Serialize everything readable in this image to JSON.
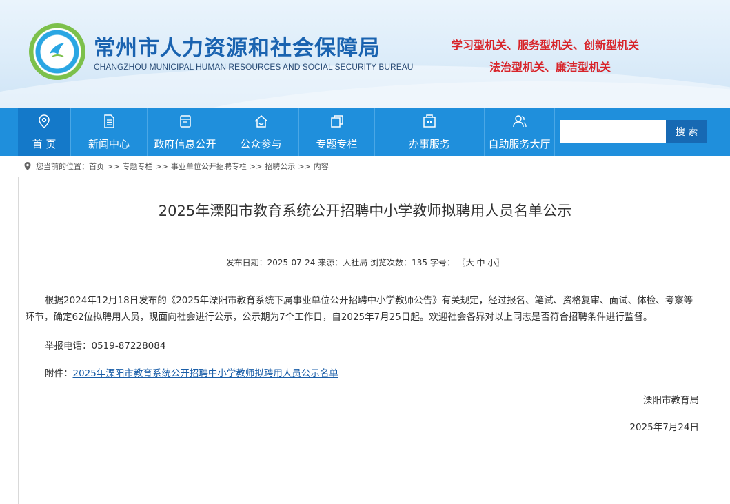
{
  "header": {
    "title": "常州市人力资源和社会保障局",
    "subtitle": "CHANGZHOU MUNICIPAL HUMAN RESOURCES AND SOCIAL SECURITY BUREAU",
    "slogan_line1": "学习型机关、服务型机关、创新型机关",
    "slogan_line2": "法治型机关、廉洁型机关",
    "colors": {
      "title": "#1a63b0",
      "slogan": "#d8242a",
      "nav": "#1f8fdc"
    }
  },
  "nav": {
    "items": [
      {
        "label": "首 页",
        "icon": "location-pin-icon",
        "active": true
      },
      {
        "label": "新闻中心",
        "icon": "document-icon"
      },
      {
        "label": "政府信息公开",
        "icon": "inbox-icon"
      },
      {
        "label": "公众参与",
        "icon": "house-icon"
      },
      {
        "label": "专题专栏",
        "icon": "copy-icon"
      },
      {
        "label": "办事服务",
        "icon": "building-icon"
      },
      {
        "label": "自助服务大厅",
        "icon": "users-icon"
      }
    ],
    "search_button": "搜 索",
    "search_value": ""
  },
  "breadcrumb": {
    "prefix": "您当前的位置：",
    "items": [
      "首页",
      "专题专栏",
      "事业单位公开招聘专栏",
      "招聘公示",
      "内容"
    ],
    "separator": ">>"
  },
  "article": {
    "title": "2025年溧阳市教育系统公开招聘中小学教师拟聘用人员名单公示",
    "meta_date_label": "发布日期：",
    "meta_date": "2025-07-24",
    "meta_source_label": "来源：",
    "meta_source": "人社局",
    "meta_views_label": "浏览次数：",
    "meta_views": "135",
    "meta_fontsize_label": "字号：",
    "fontsize_open": "〖",
    "fontsize_large": "大",
    "fontsize_medium": "中",
    "fontsize_small": "小",
    "fontsize_close": "〗",
    "paragraph": "根据2024年12月18日发布的《2025年溧阳市教育系统下属事业单位公开招聘中小学教师公告》有关规定，经过报名、笔试、资格复审、面试、体检、考察等环节，确定62位拟聘用人员，现面向社会进行公示，公示期为7个工作日，自2025年7月25日起。欢迎社会各界对以上同志是否符合招聘条件进行监督。",
    "contact_label": "举报电话：",
    "contact_phone": "0519-87228084",
    "attachment_label": "附件：",
    "attachment_link": "2025年溧阳市教育系统公开招聘中小学教师拟聘用人员公示名单",
    "sign_org": "溧阳市教育局",
    "sign_date": "2025年7月24日"
  }
}
